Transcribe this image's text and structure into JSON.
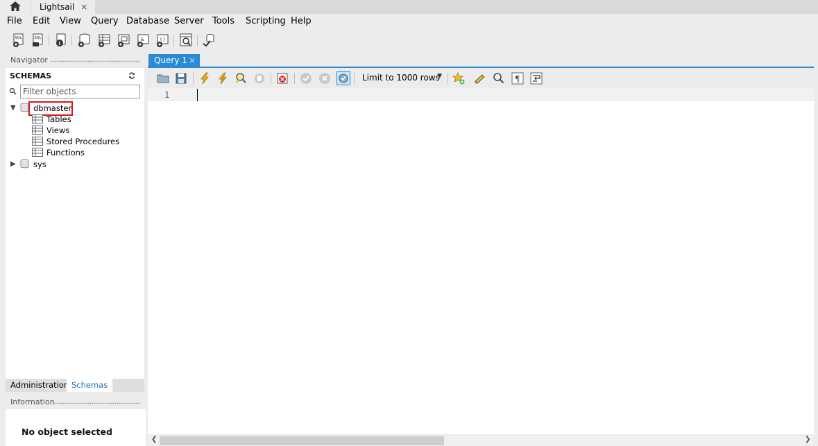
{
  "top_tabs": {
    "home_icon": "home-icon",
    "app_tab_label": "Lightsail",
    "app_tab_close": "×"
  },
  "menu": [
    "File",
    "Edit",
    "View",
    "Query",
    "Database",
    "Server",
    "Tools",
    "Scripting",
    "Help"
  ],
  "navigator": {
    "header": "Navigator",
    "schemas_label": "SCHEMAS",
    "filter_placeholder": "Filter objects",
    "schemas": [
      {
        "name": "dbmaster",
        "expanded": true,
        "highlighted": true,
        "children": [
          "Tables",
          "Views",
          "Stored Procedures",
          "Functions"
        ]
      },
      {
        "name": "sys",
        "expanded": false
      }
    ],
    "bottom_tabs": [
      "Administration",
      "Schemas"
    ],
    "active_bottom_tab": "Schemas"
  },
  "information": {
    "header": "Information",
    "message": "No object selected"
  },
  "editor": {
    "tab_label": "Query 1",
    "tab_close": "×",
    "limit_select": "Limit to 1000 rows",
    "line_numbers": [
      "1"
    ]
  },
  "colors": {
    "accent": "#2b8ad4",
    "highlight_box": "#e0151b",
    "link_tab": "#1e6fb0"
  }
}
